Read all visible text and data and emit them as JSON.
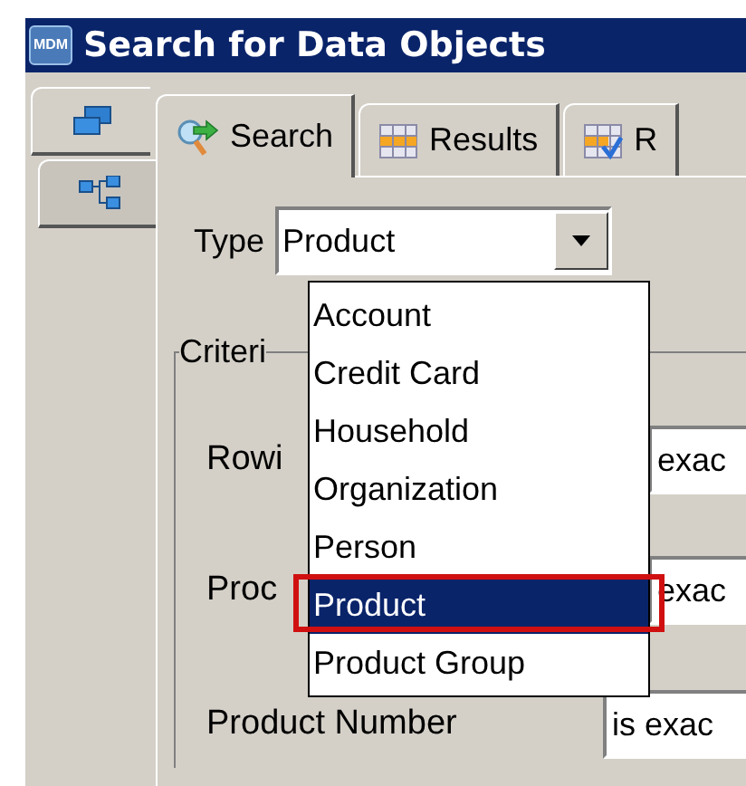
{
  "window": {
    "app_icon": "MDM",
    "title": "Search for Data Objects"
  },
  "side_tabs": [
    {
      "kind": "windows",
      "selected": true
    },
    {
      "kind": "tree",
      "selected": false
    }
  ],
  "tabs": [
    {
      "label": "Search",
      "kind": "search",
      "selected": true
    },
    {
      "label": "Results",
      "kind": "grid",
      "selected": false
    },
    {
      "label": "R",
      "kind": "checked-grid",
      "selected": false
    }
  ],
  "type_field": {
    "label": "Type",
    "value": "Product",
    "options": [
      {
        "label": "Account",
        "selected": false,
        "highlighted": false
      },
      {
        "label": "Credit Card",
        "selected": false,
        "highlighted": false
      },
      {
        "label": "Household",
        "selected": false,
        "highlighted": false
      },
      {
        "label": "Organization",
        "selected": false,
        "highlighted": false
      },
      {
        "label": "Person",
        "selected": false,
        "highlighted": false
      },
      {
        "label": "Product",
        "selected": true,
        "highlighted": true
      },
      {
        "label": "Product Group",
        "selected": false,
        "highlighted": false
      }
    ]
  },
  "criteria": {
    "title": "Criteri",
    "rows": [
      {
        "label": "Rowi",
        "operator": "exac"
      },
      {
        "label": "Proc",
        "operator": "exac"
      },
      {
        "label": "Product Number",
        "operator": "is exac"
      }
    ]
  }
}
